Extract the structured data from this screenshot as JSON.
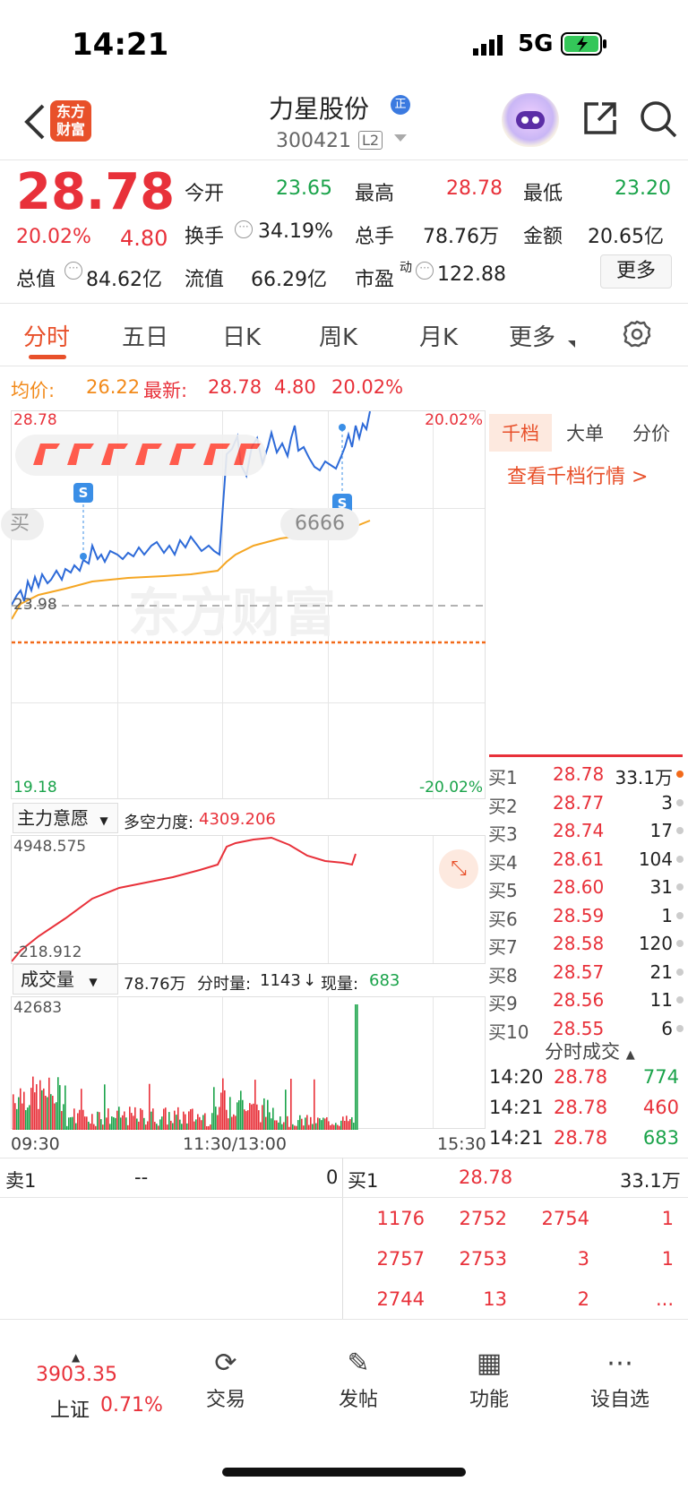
{
  "status_bar": {
    "time": "14:21",
    "network": "5G"
  },
  "header": {
    "logo_text": "东方财富",
    "stock_name": "力星股份",
    "badge": "正",
    "stock_code": "300421",
    "level": "L2"
  },
  "quote": {
    "price": "28.78",
    "change_pct": "20.02%",
    "change": "4.80",
    "open_label": "今开",
    "open": "23.65",
    "high_label": "最高",
    "high": "28.78",
    "low_label": "最低",
    "low": "23.20",
    "turnover_label": "换手",
    "turnover": "34.19%",
    "volume_label": "总手",
    "volume": "78.76万",
    "amount_label": "金额",
    "amount": "20.65亿",
    "mktcap_label": "总值",
    "mktcap": "84.62亿",
    "float_label": "流值",
    "float": "66.29亿",
    "pe_label": "市盈",
    "pe_sup": "动",
    "pe": "122.88",
    "more_label": "更多"
  },
  "tabs": [
    "分时",
    "五日",
    "日K",
    "周K",
    "月K",
    "更多"
  ],
  "legend": {
    "avg_label": "均价:",
    "avg": "26.22",
    "last_label": "最新:",
    "last": "28.78",
    "chg": "4.80",
    "pct": "20.02%"
  },
  "main_chart": {
    "top_price": "28.78",
    "bottom_price": "19.18",
    "ref_price": "23.98",
    "top_pct": "20.02%",
    "bottom_pct": "-20.02%",
    "buy_pill": "买",
    "num_pill": "6666",
    "s_badge": "S",
    "watermark": "东方财富"
  },
  "indicator": {
    "name": "主力意愿",
    "label": "多空力度:",
    "value": "4309.206",
    "max": "4948.575",
    "min": "-218.912"
  },
  "volume": {
    "name": "成交量",
    "total": "78.76万",
    "time_label": "分时量:",
    "time_vol": "1143",
    "arrow": "↓",
    "now_label": "现量:",
    "now": "683",
    "max": "42683",
    "t_open": "09:30",
    "t_mid": "11:30/13:00",
    "t_close": "15:30"
  },
  "side_tabs": [
    "千档",
    "大单",
    "分价"
  ],
  "side_link": "查看千档行情 >",
  "bids": [
    {
      "label": "买1",
      "price": "28.78",
      "qty": "33.1万"
    },
    {
      "label": "买2",
      "price": "28.77",
      "qty": "3"
    },
    {
      "label": "买3",
      "price": "28.74",
      "qty": "17"
    },
    {
      "label": "买4",
      "price": "28.61",
      "qty": "104"
    },
    {
      "label": "买5",
      "price": "28.60",
      "qty": "31"
    },
    {
      "label": "买6",
      "price": "28.59",
      "qty": "1"
    },
    {
      "label": "买7",
      "price": "28.58",
      "qty": "120"
    },
    {
      "label": "买8",
      "price": "28.57",
      "qty": "21"
    },
    {
      "label": "买9",
      "price": "28.56",
      "qty": "11"
    },
    {
      "label": "买10",
      "price": "28.55",
      "qty": "6"
    }
  ],
  "ticks_header": "分时成交",
  "ticks": [
    {
      "time": "14:20",
      "price": "28.78",
      "vol": "774"
    },
    {
      "time": "14:21",
      "price": "28.78",
      "vol": "460"
    },
    {
      "time": "14:21",
      "price": "28.78",
      "vol": "683"
    }
  ],
  "bottom_book": {
    "sell_label": "卖1",
    "sell_price": "--",
    "sell_qty": "0",
    "buy_label": "买1",
    "buy_price": "28.78",
    "buy_qty": "33.1万",
    "queue": [
      [
        "1176",
        "2752",
        "2754",
        "1"
      ],
      [
        "2757",
        "2753",
        "3",
        "1"
      ],
      [
        "2744",
        "13",
        "2",
        "..."
      ]
    ]
  },
  "index": {
    "value": "3903.35",
    "name": "上证",
    "pct": "0.71%"
  },
  "nav": [
    {
      "label": "交易",
      "icon": "trade-icon"
    },
    {
      "label": "发帖",
      "icon": "post-icon"
    },
    {
      "label": "功能",
      "icon": "apps-icon"
    },
    {
      "label": "设自选",
      "icon": "more-icon"
    }
  ],
  "colors": {
    "up": "#e8313a",
    "down": "#1aa34a",
    "accent": "#e8502a",
    "price_line": "#2d6ad8",
    "avg_line": "#f5a623"
  }
}
